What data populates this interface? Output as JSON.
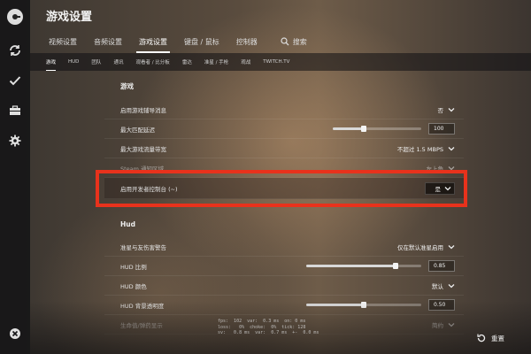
{
  "title": "游戏设置",
  "tabs": [
    {
      "label": "视频设置",
      "active": false
    },
    {
      "label": "音频设置",
      "active": false
    },
    {
      "label": "游戏设置",
      "active": true
    },
    {
      "label": "键盘 / 鼠标",
      "active": false
    },
    {
      "label": "控制器",
      "active": false
    }
  ],
  "search": {
    "label": "搜索",
    "icon": "search-icon"
  },
  "subtabs": [
    {
      "label": "游戏",
      "active": true
    },
    {
      "label": "HUD",
      "active": false
    },
    {
      "label": "团队",
      "active": false
    },
    {
      "label": "通讯",
      "active": false
    },
    {
      "label": "观看者 / 比分板",
      "active": false
    },
    {
      "label": "雷达",
      "active": false
    },
    {
      "label": "准星 / 手枪",
      "active": false
    },
    {
      "label": "观战",
      "active": false
    },
    {
      "label": "TWITCH.TV",
      "active": false
    }
  ],
  "sections": {
    "game": {
      "title": "游戏",
      "rows": [
        {
          "label": "启用游戏辅导消息",
          "value": "否"
        },
        {
          "label": "最大匹配延迟",
          "value": "100",
          "slider": 0.35
        },
        {
          "label": "最大游戏流量带宽",
          "value": "不超过 1.5 MBPS"
        },
        {
          "label": "Steam 通知区域",
          "value": "左上角"
        },
        {
          "label": "启用开发者控制台 (~)",
          "value": "是"
        }
      ]
    },
    "hud": {
      "title": "Hud",
      "rows": [
        {
          "label": "准星与友伤害警告",
          "value": "仅在默认准星启用"
        },
        {
          "label": "HUD 比例",
          "value": "0.85",
          "slider": 0.78
        },
        {
          "label": "HUD 颜色",
          "value": "默认"
        },
        {
          "label": "HUD 背景透明度",
          "value": "0.50",
          "slider": 0.5
        },
        {
          "label": "生命值/弹药显示",
          "value": "简约"
        }
      ]
    }
  },
  "overlay_lines": [
    "fps:  102  var:  0.3 ms  on: 0 ms",
    "loss:   0%  choke:  0%  tick: 128",
    "sv:   0.8 ms  var:  0.7 ms  +-  0.0 ms"
  ],
  "reset_label": "重置",
  "colors": {
    "highlight_border": "#e8321c",
    "sidebar": "#141416"
  }
}
